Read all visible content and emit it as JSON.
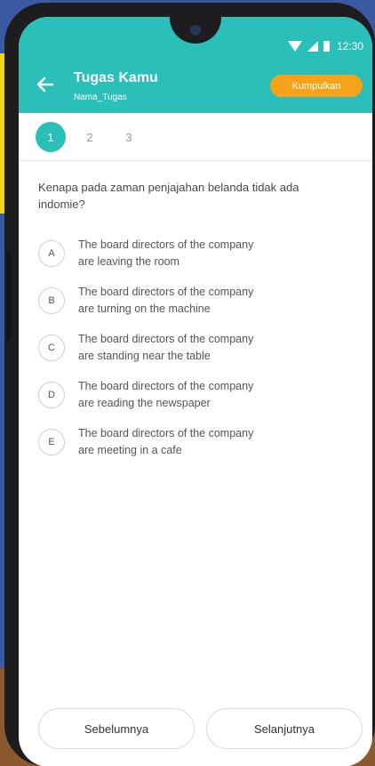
{
  "status_bar": {
    "time": "12:30"
  },
  "header": {
    "title": "Tugas Kamu",
    "subtitle": "Nama_Tugas",
    "submit_label": "Kumpulkan"
  },
  "question_tabs": [
    "1",
    "2",
    "3"
  ],
  "active_tab": "1",
  "question": {
    "text": "Kenapa pada zaman penjajahan belanda tidak ada indomie?",
    "options": [
      {
        "letter": "A",
        "line1": "The board directors of the company",
        "line2": "are leaving the room"
      },
      {
        "letter": "B",
        "line1": "The board directors of the company",
        "line2": "are turning on the machine"
      },
      {
        "letter": "C",
        "line1": "The board directors of the company",
        "line2": "are standing near the table"
      },
      {
        "letter": "D",
        "line1": "The board directors of the company",
        "line2": "are reading the newspaper"
      },
      {
        "letter": "E",
        "line1": "The board directors of the company",
        "line2": "are meeting in a cafe"
      }
    ]
  },
  "navigation": {
    "prev_label": "Sebelumnya",
    "next_label": "Selanjutnya"
  },
  "colors": {
    "primary": "#2bbfb9",
    "accent": "#f7a21a"
  },
  "icons": {
    "back": "arrow-left-icon",
    "wifi": "wifi-icon",
    "signal": "signal-icon",
    "battery": "battery-icon"
  }
}
